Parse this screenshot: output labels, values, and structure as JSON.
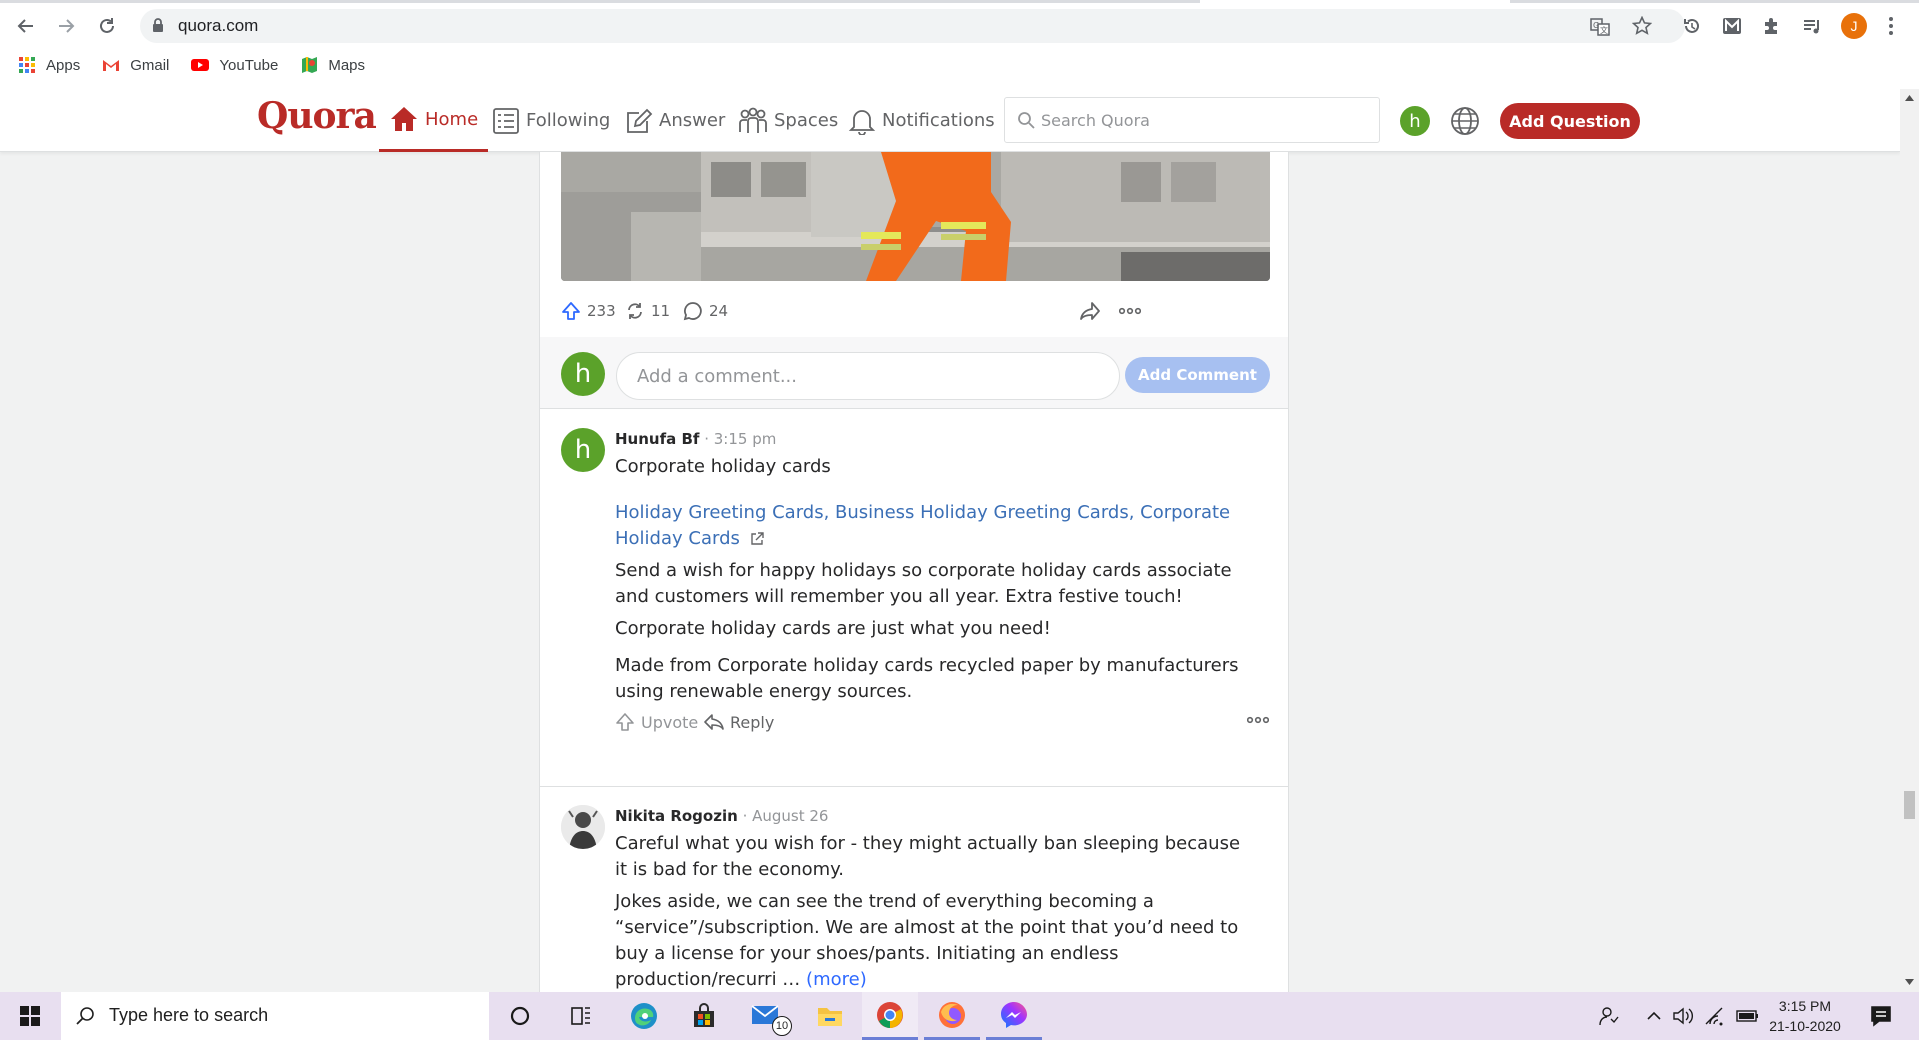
{
  "browser": {
    "url": "quora.com",
    "bookmarks": [
      {
        "label": "Apps",
        "icon": "apps-grid-icon"
      },
      {
        "label": "Gmail",
        "icon": "gmail-icon"
      },
      {
        "label": "YouTube",
        "icon": "youtube-icon"
      },
      {
        "label": "Maps",
        "icon": "maps-icon"
      }
    ],
    "profile_initial": "J"
  },
  "quora": {
    "logo": "Quora",
    "nav": [
      {
        "label": "Home",
        "icon": "home-icon",
        "active": true
      },
      {
        "label": "Following",
        "icon": "following-icon"
      },
      {
        "label": "Answer",
        "icon": "answer-icon"
      },
      {
        "label": "Spaces",
        "icon": "spaces-icon"
      },
      {
        "label": "Notifications",
        "icon": "bell-icon"
      }
    ],
    "search_placeholder": "Search Quora",
    "user_initial": "h",
    "add_question": "Add Question",
    "accent": "#b92b27"
  },
  "post": {
    "upvotes": "233",
    "shares": "11",
    "comments": "24"
  },
  "comment_box": {
    "placeholder": "Add a comment...",
    "button": "Add Comment",
    "avatar_initial": "h"
  },
  "comments": [
    {
      "author": "Hunufa Bf",
      "time": "· 3:15 pm",
      "avatar_initial": "h",
      "paragraphs": [
        "Corporate holiday cards",
        "Send a wish for happy holidays so corporate holiday cards associate and customers will remember you all year. Extra festive touch!",
        "Corporate holiday cards are just what you need!",
        "Made from Corporate holiday cards recycled paper by manufacturers using renewable energy sources."
      ],
      "links": "Holiday Greeting Cards, Business Holiday Greeting Cards, Corporate Holiday Cards",
      "upvote_label": "Upvote",
      "reply_label": "Reply"
    },
    {
      "author": "Nikita Rogozin",
      "time": "· August 26",
      "paragraphs": [
        "Careful what you wish for - they might actually ban sleeping because it is bad for the economy.",
        "Jokes aside, we can see the trend of everything becoming a “service”/subscription. We are almost at the point that you’d need to buy a license for your shoes/pants. Initiating an endless production/recurri …"
      ],
      "more_label": "(more)"
    }
  ],
  "taskbar": {
    "search_placeholder": "Type here to search",
    "mail_badge": "10",
    "time": "3:15 PM",
    "date": "21-10-2020"
  }
}
